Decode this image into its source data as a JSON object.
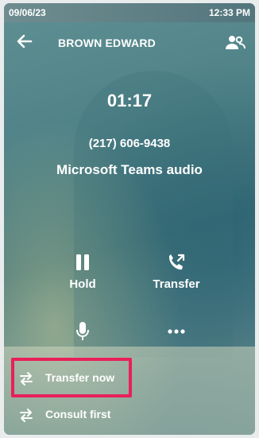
{
  "status_bar": {
    "date": "09/06/23",
    "time": "12:33 PM"
  },
  "header": {
    "contact_name": "BROWN EDWARD"
  },
  "call": {
    "duration": "01:17",
    "phone_number": "(217) 606-9438",
    "audio_source": "Microsoft Teams audio"
  },
  "actions": {
    "hold_label": "Hold",
    "transfer_label": "Transfer"
  },
  "transfer_options": {
    "now_label": "Transfer now",
    "consult_label": "Consult first"
  },
  "colors": {
    "highlight": "#e8205a"
  },
  "icons": [
    "back-arrow-icon",
    "people-icon",
    "pause-icon",
    "phone-transfer-icon",
    "microphone-icon",
    "more-icon",
    "transfer-arrows-icon"
  ]
}
